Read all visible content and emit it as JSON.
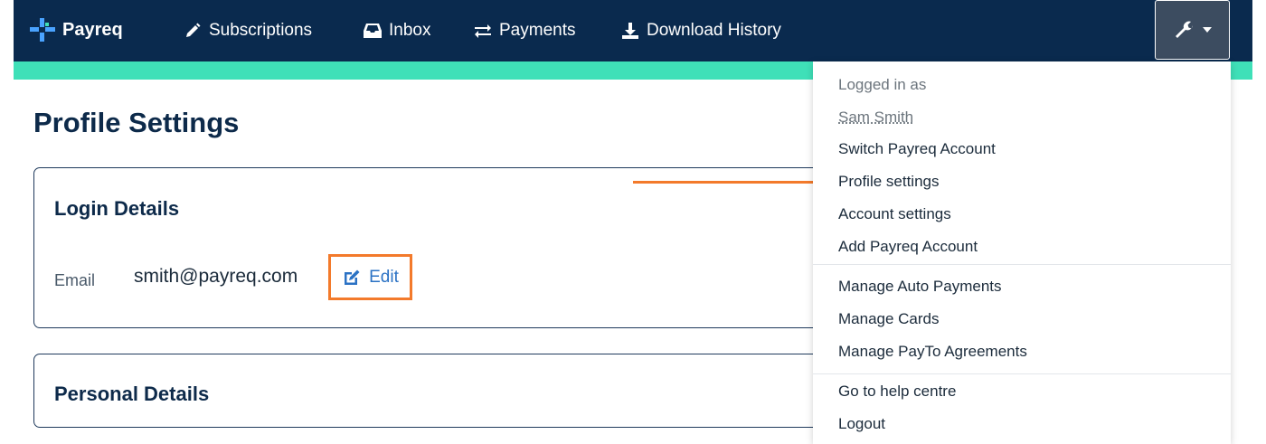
{
  "nav": {
    "brand": "Payreq",
    "items": [
      {
        "label": "Subscriptions",
        "icon": "pencil-icon"
      },
      {
        "label": "Inbox",
        "icon": "inbox-icon"
      },
      {
        "label": "Payments",
        "icon": "exchange-icon"
      },
      {
        "label": "Download History",
        "icon": "download-icon"
      }
    ],
    "settings_icon": "wrench-icon"
  },
  "page": {
    "title": "Profile Settings",
    "login_card": {
      "title": "Login Details",
      "email_label": "Email",
      "email_value": "smith@payreq.com",
      "edit_label": "Edit"
    },
    "personal_card": {
      "title": "Personal Details"
    }
  },
  "dropdown": {
    "logged_in_as": "Logged in as",
    "user_name": "Sam Smith",
    "group1": [
      "Switch Payreq Account",
      "Profile settings",
      "Account settings",
      "Add Payreq Account"
    ],
    "group2": [
      "Manage Auto Payments",
      "Manage Cards",
      "Manage PayTo Agreements"
    ],
    "group3": [
      "Go to help centre",
      "Logout"
    ]
  },
  "colors": {
    "navbar": "#0a2a4e",
    "accent_teal": "#3fe0b8",
    "highlight_orange": "#f37a2b",
    "link_blue": "#2b72c4"
  }
}
